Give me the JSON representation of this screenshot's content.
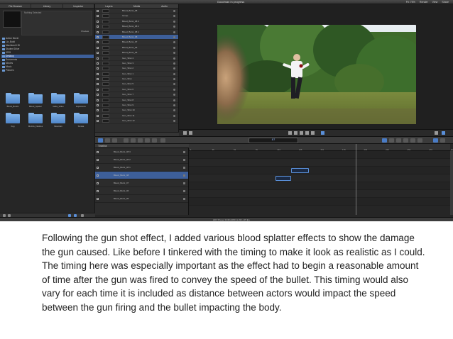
{
  "window": {
    "title": "Goodman in progress",
    "right_menu": [
      "Fit: 75%",
      "Render",
      "View",
      "Share"
    ]
  },
  "browser": {
    "tabs": [
      "File Browser",
      "Library",
      "Inspector"
    ],
    "preview_info": "Nothing Selected",
    "preview_side_label": "Preview",
    "tree": [
      {
        "label": "Action Movie",
        "selected": false
      },
      {
        "label": "Liz_Build",
        "selected": false
      },
      {
        "label": "Macintosh HD",
        "selected": false
      },
      {
        "label": "Student Drive",
        "selected": false
      },
      {
        "label": "iOS5",
        "selected": false
      },
      {
        "label": "Desktop",
        "selected": true
      },
      {
        "label": "Documents",
        "selected": false
      },
      {
        "label": "Movies",
        "selected": false
      },
      {
        "label": "Music",
        "selected": false
      },
      {
        "label": "Pictures",
        "selected": false
      }
    ],
    "folders": [
      "Blood_Bursts",
      "Blood_Spatter",
      "Gabs_Video",
      "Explosions",
      "Fog",
      "Muzzle_Flashes",
      "Mountain",
      "Smoke"
    ]
  },
  "layers": {
    "tabs": [
      "Layers",
      "Media",
      "Audio"
    ],
    "rows": [
      {
        "name": "Blood_Burst_08",
        "selected": false
      },
      {
        "name": "Group",
        "selected": false
      },
      {
        "name": "Blood_Burst_08 3",
        "selected": false
      },
      {
        "name": "Blood_Burst_08 2",
        "selected": false
      },
      {
        "name": "Blood_Burst_08 1",
        "selected": false
      },
      {
        "name": "Blood_Burst_08",
        "selected": true
      },
      {
        "name": "Blood_Burst_07",
        "selected": false
      },
      {
        "name": "Blood_Burst_06",
        "selected": false
      },
      {
        "name": "Blood_Burst_05",
        "selected": false
      },
      {
        "name": "Gun_Shot 4",
        "selected": false
      },
      {
        "name": "Gun_Shot 3",
        "selected": false
      },
      {
        "name": "Gun_Shot 2",
        "selected": false
      },
      {
        "name": "Gun_Shot 1",
        "selected": false
      },
      {
        "name": "Gun_Shot",
        "selected": false
      },
      {
        "name": "Gun_Shot 5",
        "selected": false
      },
      {
        "name": "Gun_Shot 6",
        "selected": false
      },
      {
        "name": "Gun_Shot 7",
        "selected": false
      },
      {
        "name": "Gun_Shot 8",
        "selected": false
      },
      {
        "name": "Gun_Shot 9",
        "selected": false
      },
      {
        "name": "Gun_Shot 10",
        "selected": false
      },
      {
        "name": "Gun_Shot 11",
        "selected": false
      },
      {
        "name": "Gun_Shot 12",
        "selected": false
      }
    ]
  },
  "toolbar": {
    "timecode": "87"
  },
  "timeline": {
    "header": "Timeline",
    "ruler_ticks": [
      "1",
      "26",
      "51",
      "76",
      "101",
      "126",
      "151",
      "176",
      "201",
      "226",
      "251",
      "276",
      "301"
    ],
    "rows": [
      {
        "name": "Blood_Burst_08 3",
        "selected": false,
        "clip_start": 0,
        "clip_len": 0
      },
      {
        "name": "Blood_Burst_08 2",
        "selected": false,
        "clip_start": 0,
        "clip_len": 0
      },
      {
        "name": "Blood_Burst_08 1",
        "selected": false,
        "clip_start": 118,
        "clip_len": 20
      },
      {
        "name": "Blood_Burst_08",
        "selected": true,
        "clip_start": 100,
        "clip_len": 18
      },
      {
        "name": "Blood_Burst_07",
        "selected": false,
        "clip_start": 0,
        "clip_len": 0
      },
      {
        "name": "Blood_Burst_06",
        "selected": false,
        "clip_start": 0,
        "clip_len": 0
      },
      {
        "name": "Blood_Burst_05",
        "selected": false,
        "clip_start": 0,
        "clip_len": 0
      }
    ]
  },
  "status": {
    "text": "HDV Preset 1440x1080 (1.33:1) 25 fps"
  },
  "caption": "Following the gun shot effect, I added various blood splatter effects to show the damage the gun caused. Like before I tinkered with the timing to make it look as realistic as I could. The timing here was especially important as the effect had to begin a reasonable amount of time after the gun was fired to convey the speed of the bullet. This timing would also vary for each time it is included as distance between actors would impact the speed between the gun firing and the bullet impacting the body."
}
